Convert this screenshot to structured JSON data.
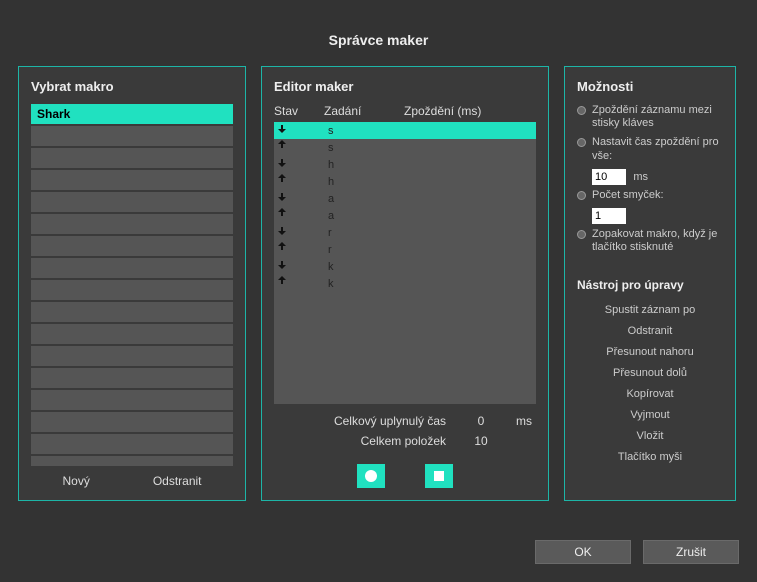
{
  "title": "Správce maker",
  "left": {
    "heading": "Vybrat makro",
    "items": [
      "Shark"
    ],
    "selected": 0,
    "empty_slots": 16,
    "new_label": "Nový",
    "delete_label": "Odstranit"
  },
  "mid": {
    "heading": "Editor maker",
    "cols": {
      "state": "Stav",
      "input": "Zadání",
      "delay": "Zpoždění (ms)"
    },
    "rows": [
      {
        "dir": "down",
        "key": "s"
      },
      {
        "dir": "up",
        "key": "s"
      },
      {
        "dir": "down",
        "key": "h"
      },
      {
        "dir": "up",
        "key": "h"
      },
      {
        "dir": "down",
        "key": "a"
      },
      {
        "dir": "up",
        "key": "a"
      },
      {
        "dir": "down",
        "key": "r"
      },
      {
        "dir": "up",
        "key": "r"
      },
      {
        "dir": "down",
        "key": "k"
      },
      {
        "dir": "up",
        "key": "k"
      }
    ],
    "selected": 0,
    "totals": {
      "elapsed_label": "Celkový uplynulý čas",
      "elapsed_value": "0",
      "elapsed_unit": "ms",
      "items_label": "Celkem položek",
      "items_value": "10"
    }
  },
  "right": {
    "heading": "Možnosti",
    "opts": {
      "between": "Zpoždění záznamu mezi stisky kláves",
      "set_all": "Nastavit čas zpoždění pro vše:",
      "set_all_value": "10",
      "set_all_unit": "ms",
      "loops": "Počet smyček:",
      "loops_value": "1",
      "repeat": "Zopakovat makro, když je tlačítko stisknuté"
    },
    "tools_heading": "Nástroj pro úpravy",
    "tools": [
      "Spustit záznam po",
      "Odstranit",
      "Přesunout nahoru",
      "Přesunout dolů",
      "Kopírovat",
      "Vyjmout",
      "Vložit",
      "Tlačítko myši"
    ]
  },
  "footer": {
    "ok": "OK",
    "cancel": "Zrušit"
  }
}
